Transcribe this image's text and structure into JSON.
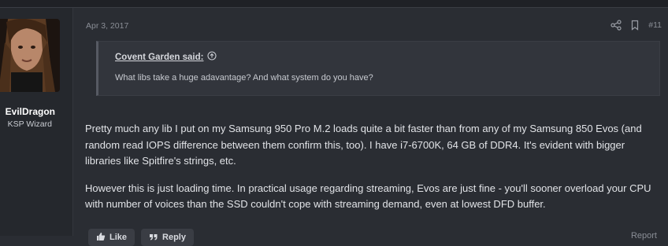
{
  "post": {
    "date": "Apr 3, 2017",
    "number": "#11",
    "user": {
      "name": "EvilDragon",
      "title": "KSP Wizard"
    },
    "quote": {
      "author": "Covent Garden said:",
      "text": "What libs take a huge adavantage? And what system do you have?"
    },
    "paragraphs": [
      "Pretty much any lib I put on my Samsung 950 Pro M.2 loads quite a bit faster than from any of my Samsung 850 Evos (and random read IOPS difference between them confirm this, too). I have i7-6700K, 64 GB of DDR4. It's evident with bigger libraries like Spitfire's strings, etc.",
      "However this is just loading time. In practical usage regarding streaming, Evos are just fine - you'll sooner overload your CPU with number of voices than the SSD couldn't cope with streaming demand, even at lowest DFD buffer."
    ],
    "actions": {
      "like": "Like",
      "reply": "Reply",
      "report": "Report"
    },
    "icons": {
      "share": "share-icon",
      "bookmark": "bookmark-icon",
      "quote_up": "arrow-up-circle-icon",
      "like": "thumbs-up-icon",
      "reply": "quote-reply-icon"
    },
    "colors": {
      "background": "#2a2d33",
      "quote_bg": "#32353c",
      "text": "#e1e3e7",
      "muted": "#8a8e96"
    }
  }
}
